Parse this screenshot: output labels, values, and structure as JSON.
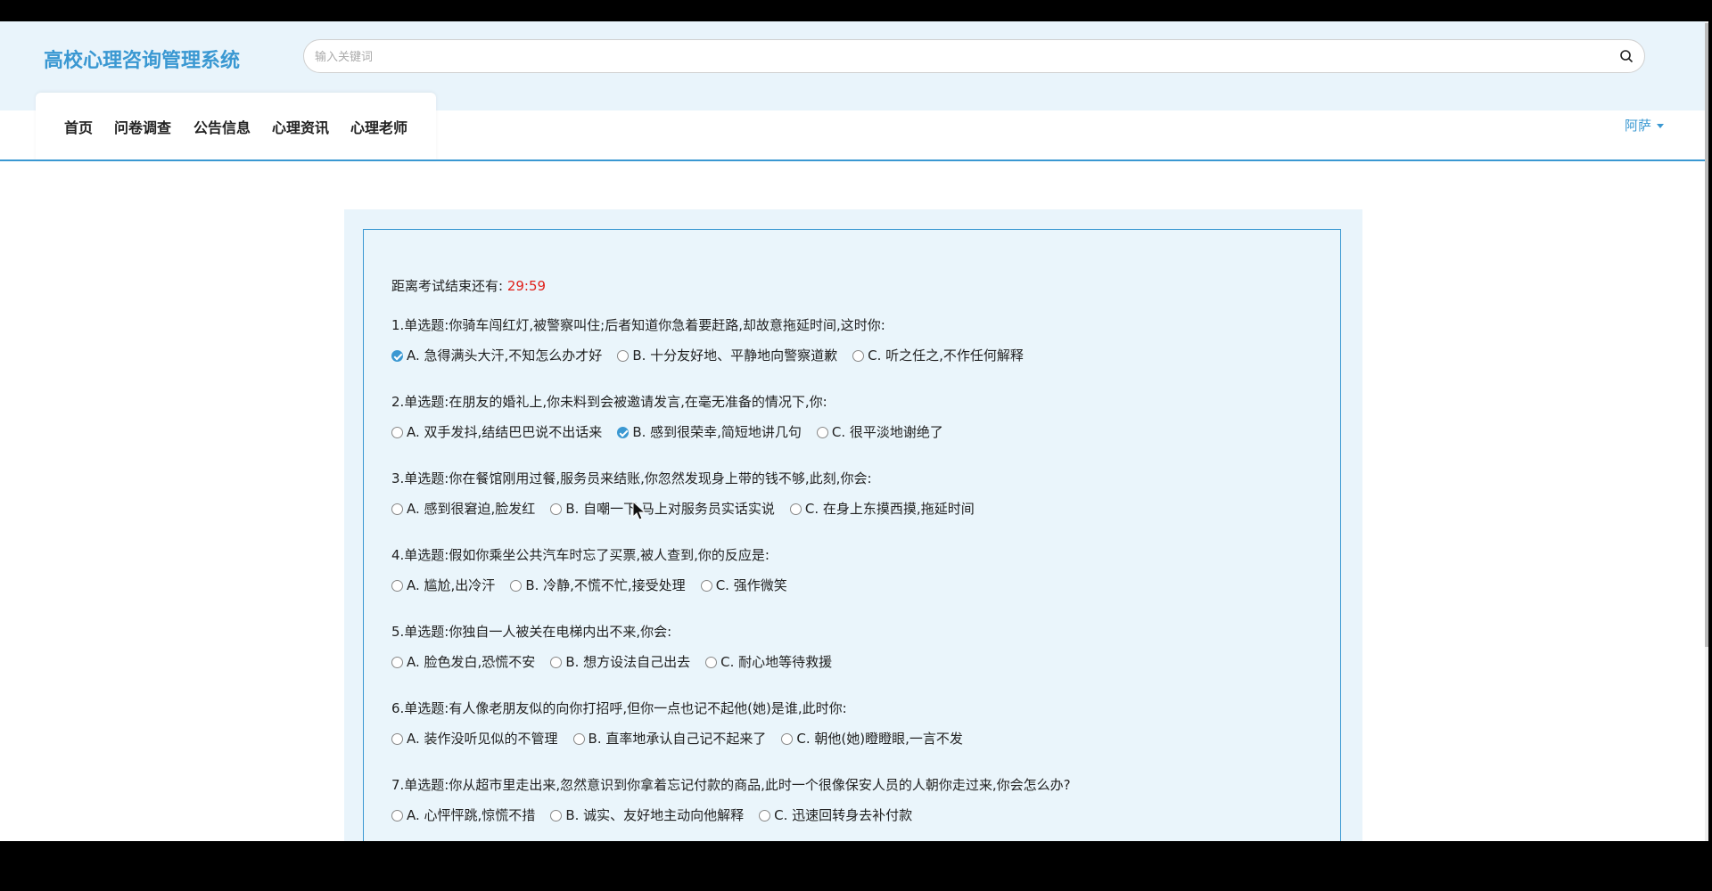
{
  "site": {
    "title": "高校心理咨询管理系统"
  },
  "search": {
    "placeholder": "输入关键词",
    "icon": "search-icon"
  },
  "nav": [
    "首页",
    "问卷调查",
    "公告信息",
    "心理资讯",
    "心理老师"
  ],
  "user": {
    "name": "阿萨"
  },
  "exam": {
    "timer_label": "距离考试结束还有:",
    "time_left": "29:59"
  },
  "colors": {
    "accent": "#3a98d2",
    "timer": "#e0201a",
    "panel_bg": "#e9f4fb"
  },
  "questions": [
    {
      "text": "1.单选题:你骑车闯红灯,被警察叫住;后者知道你急着要赶路,却故意拖延时间,这时你:",
      "options": [
        {
          "label": "A. 急得满头大汗,不知怎么办才好",
          "checked": true
        },
        {
          "label": "B. 十分友好地、平静地向警察道歉",
          "checked": false
        },
        {
          "label": "C. 听之任之,不作任何解释",
          "checked": false
        }
      ]
    },
    {
      "text": "2.单选题:在朋友的婚礼上,你未料到会被邀请发言,在毫无准备的情况下,你:",
      "options": [
        {
          "label": "A. 双手发抖,结结巴巴说不出话来",
          "checked": false
        },
        {
          "label": "B. 感到很荣幸,简短地讲几句",
          "checked": true
        },
        {
          "label": "C. 很平淡地谢绝了",
          "checked": false
        }
      ]
    },
    {
      "text": "3.单选题:你在餐馆刚用过餐,服务员来结账,你忽然发现身上带的钱不够,此刻,你会:",
      "options": [
        {
          "label": "A. 感到很窘迫,脸发红",
          "checked": false
        },
        {
          "label": "B. 自嘲一下,马上对服务员实话实说",
          "checked": false
        },
        {
          "label": "C. 在身上东摸西摸,拖延时间",
          "checked": false
        }
      ]
    },
    {
      "text": "4.单选题:假如你乘坐公共汽车时忘了买票,被人查到,你的反应是:",
      "options": [
        {
          "label": "A. 尴尬,出冷汗",
          "checked": false
        },
        {
          "label": "B. 冷静,不慌不忙,接受处理",
          "checked": false
        },
        {
          "label": "C. 强作微笑",
          "checked": false
        }
      ]
    },
    {
      "text": "5.单选题:你独自一人被关在电梯内出不来,你会:",
      "options": [
        {
          "label": "A. 脸色发白,恐慌不安",
          "checked": false
        },
        {
          "label": "B. 想方设法自己出去",
          "checked": false
        },
        {
          "label": "C. 耐心地等待救援",
          "checked": false
        }
      ]
    },
    {
      "text": "6.单选题:有人像老朋友似的向你打招呼,但你一点也记不起他(她)是谁,此时你:",
      "options": [
        {
          "label": "A. 装作没听见似的不管理",
          "checked": false
        },
        {
          "label": "B. 直率地承认自己记不起来了",
          "checked": false
        },
        {
          "label": "C. 朝他(她)瞪瞪眼,一言不发",
          "checked": false
        }
      ]
    },
    {
      "text": "7.单选题:你从超市里走出来,忽然意识到你拿着忘记付款的商品,此时一个很像保安人员的人朝你走过来,你会怎么办?",
      "options": [
        {
          "label": "A. 心怦怦跳,惊慌不措",
          "checked": false
        },
        {
          "label": "B. 诚实、友好地主动向他解释",
          "checked": false
        },
        {
          "label": "C. 迅速回转身去补付款",
          "checked": false
        }
      ]
    }
  ]
}
